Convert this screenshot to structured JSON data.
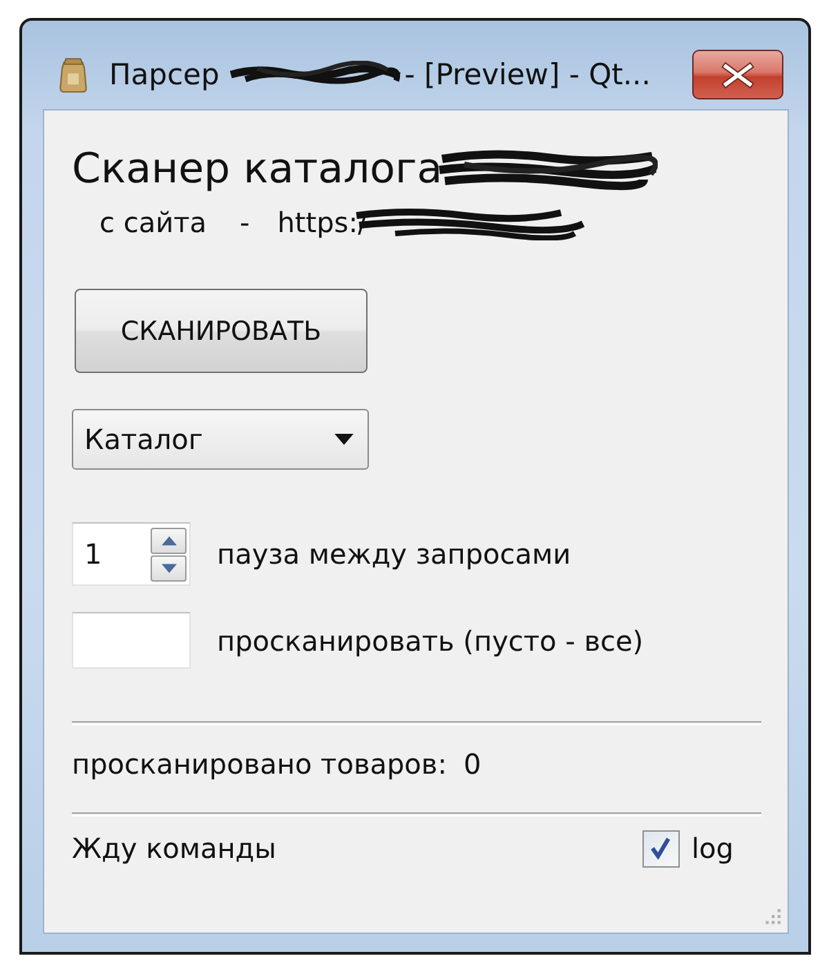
{
  "window": {
    "title_start": "Парсер",
    "title_redacted": true,
    "title_end": "- [Preview] - Qt..."
  },
  "header": {
    "title": "Сканер каталога",
    "title_redacted": true,
    "source_label": "с сайта",
    "separator": "-",
    "url": "https:/",
    "url_redacted": true
  },
  "scan_button": {
    "label": "СКАНИРОВАТЬ"
  },
  "mode_select": {
    "value": "Каталог"
  },
  "fields": [
    {
      "kind": "spin",
      "value": "1",
      "label": "пауза между запросами"
    },
    {
      "kind": "text",
      "label": "просканировать (пусто - все)"
    }
  ],
  "counter": {
    "label": "просканировано товаров:",
    "value": "0"
  },
  "status": {
    "text": "Жду команды",
    "log": {
      "label": "log",
      "checked": true
    }
  }
}
